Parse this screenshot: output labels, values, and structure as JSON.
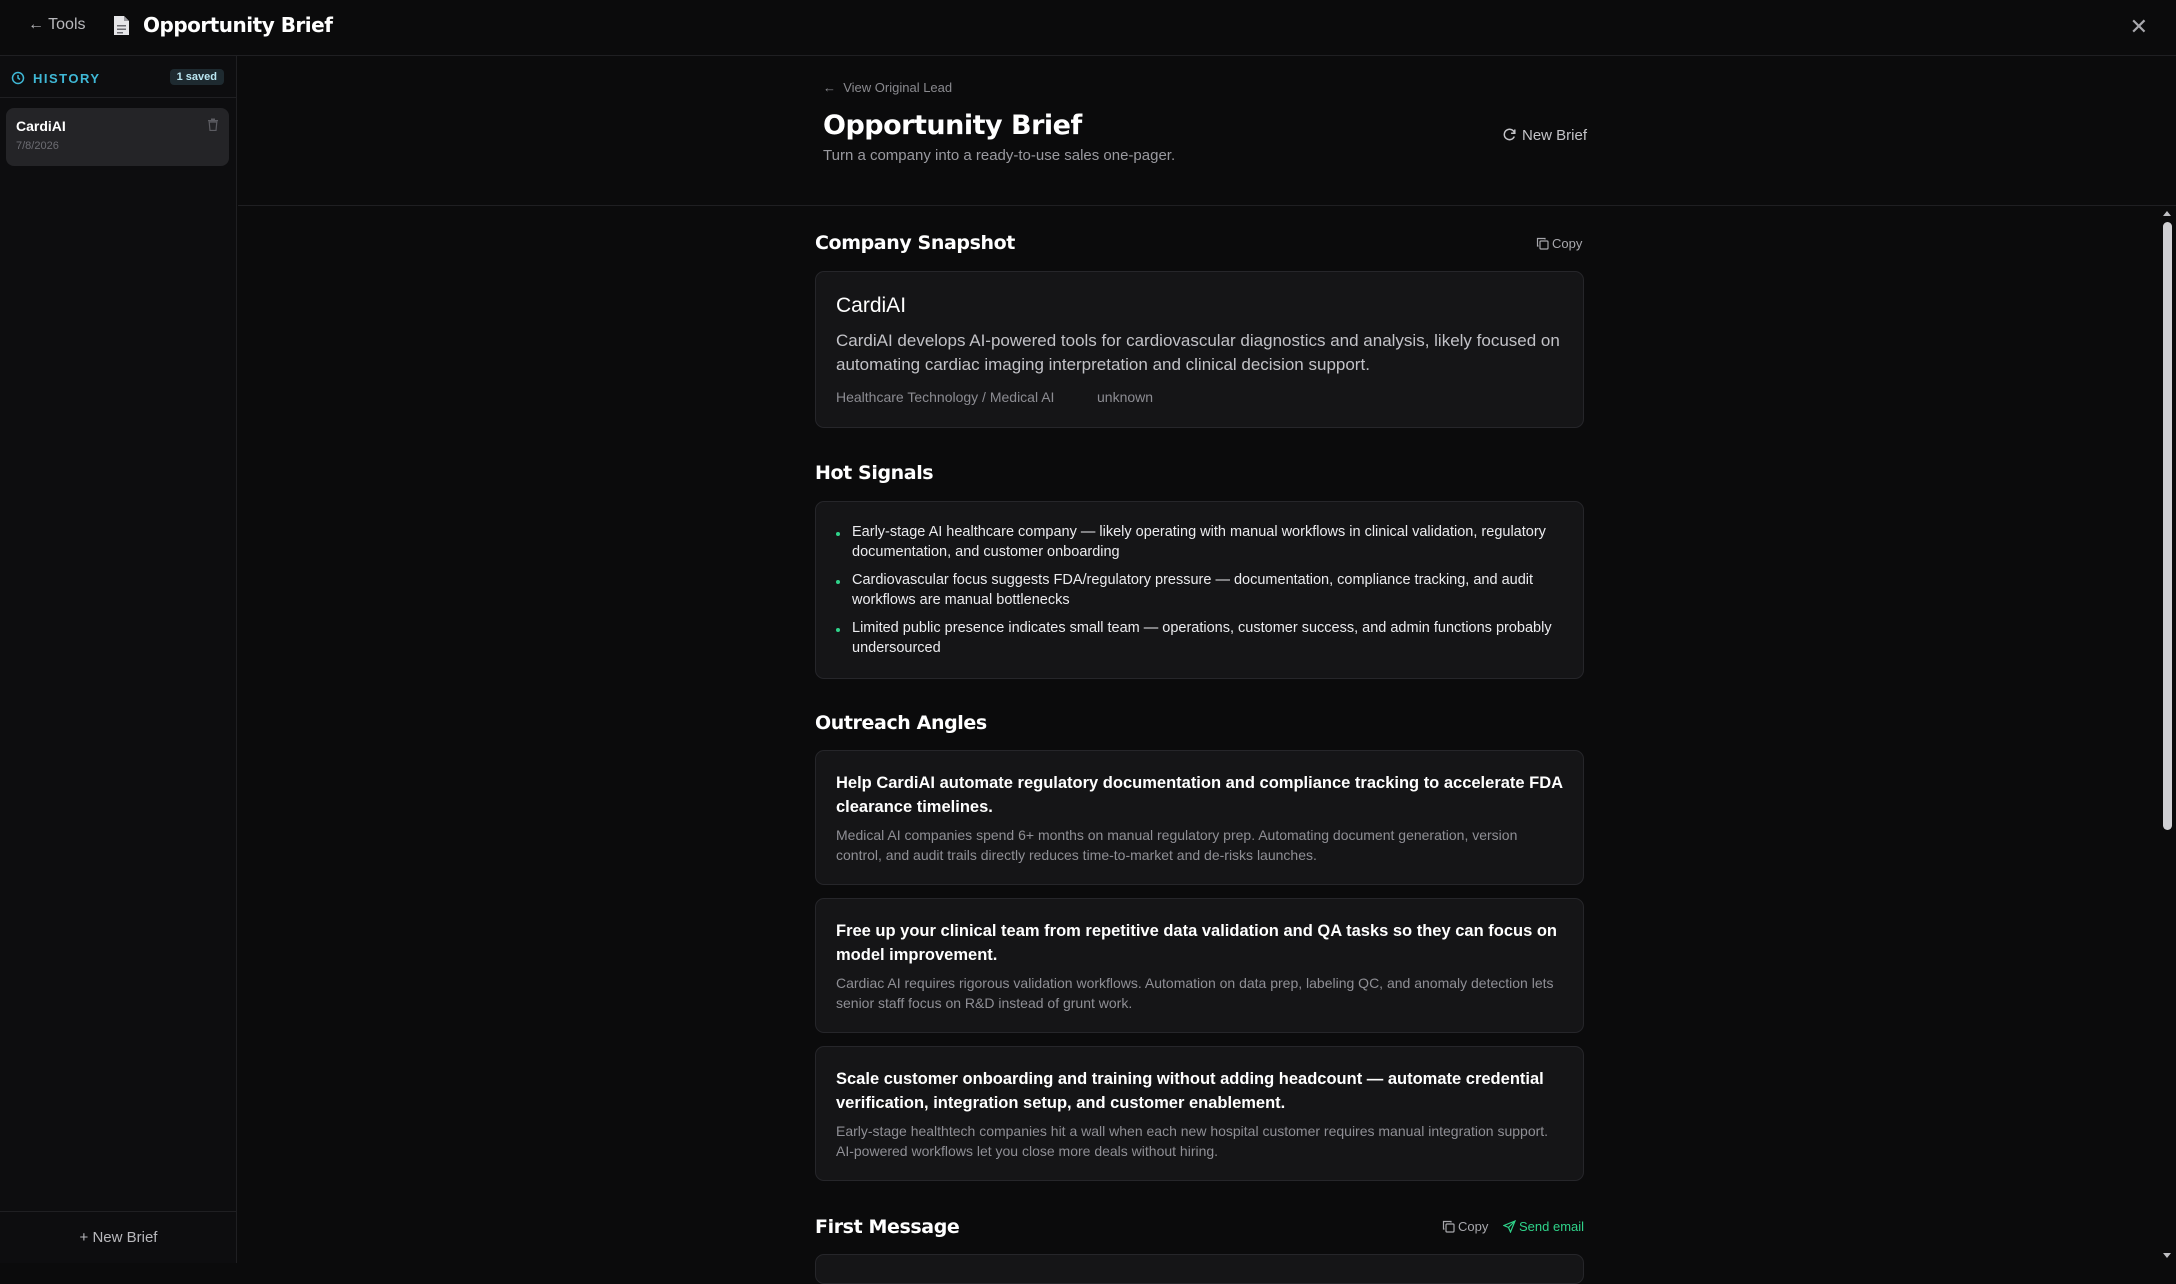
{
  "topbar": {
    "back_label": "← Tools",
    "title": "Opportunity Brief",
    "close_icon": "close-icon"
  },
  "sidebar": {
    "history_label": "HISTORY",
    "saved_badge": "1 saved",
    "items": [
      {
        "name": "CardiAI",
        "date": "7/8/2026"
      }
    ],
    "new_brief_label": "+ New Brief"
  },
  "header": {
    "view_lead_label": "View Original Lead",
    "title": "Opportunity Brief",
    "subtitle": "Turn a company into a ready-to-use sales one-pager.",
    "new_brief_label": "New Brief"
  },
  "snapshot": {
    "title": "Company Snapshot",
    "copy_label": "Copy",
    "company_name": "CardiAI",
    "description": "CardiAI develops AI-powered tools for cardiovascular diagnostics and analysis, likely focused on automating cardiac imaging interpretation and clinical decision support.",
    "industry": "Healthcare Technology / Medical AI",
    "size": "unknown"
  },
  "signals": {
    "title": "Hot Signals",
    "items": [
      "Early-stage AI healthcare company — likely operating with manual workflows in clinical validation, regulatory documentation, and customer onboarding",
      "Cardiovascular focus suggests FDA/regulatory pressure — documentation, compliance tracking, and audit workflows are manual bottlenecks",
      "Limited public presence indicates small team — operations, customer success, and admin functions probably undersourced"
    ]
  },
  "angles": {
    "title": "Outreach Angles",
    "items": [
      {
        "headline": "Help CardiAI automate regulatory documentation and compliance tracking to accelerate FDA clearance timelines.",
        "detail": "Medical AI companies spend 6+ months on manual regulatory prep. Automating document generation, version control, and audit trails directly reduces time-to-market and de-risks launches."
      },
      {
        "headline": "Free up your clinical team from repetitive data validation and QA tasks so they can focus on model improvement.",
        "detail": "Cardiac AI requires rigorous validation workflows. Automation on data prep, labeling QC, and anomaly detection lets senior staff focus on R&D instead of grunt work."
      },
      {
        "headline": "Scale customer onboarding and training without adding headcount — automate credential verification, integration setup, and customer enablement.",
        "detail": "Early-stage healthtech companies hit a wall when each new hospital customer requires manual integration support. AI-powered workflows let you close more deals without hiring."
      }
    ]
  },
  "first_message": {
    "title": "First Message",
    "copy_label": "Copy",
    "send_label": "Send email"
  },
  "colors": {
    "accent_cyan": "#3fb8d6",
    "accent_green": "#2fd38a",
    "background": "#0b0b0c",
    "card": "#151517"
  }
}
